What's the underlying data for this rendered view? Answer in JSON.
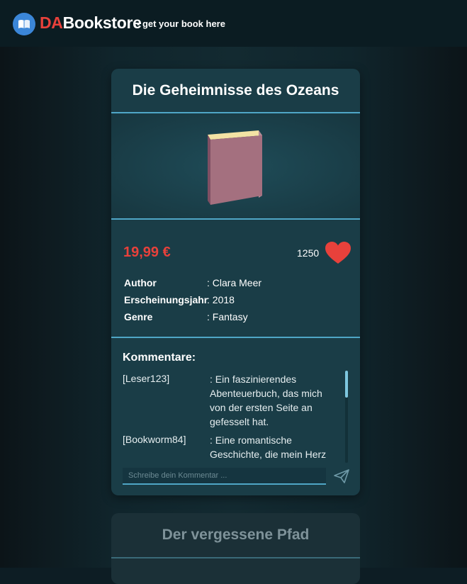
{
  "header": {
    "brand_prefix": "DA",
    "brand_rest": "Bookstore",
    "tagline": "- get your book here",
    "logo_icon": "book-icon"
  },
  "book": {
    "title": "Die Geheimnisse des Ozeans",
    "price": "19,99 €",
    "likes": "1250",
    "details": [
      {
        "label": "Author",
        "value": ": Clara Meer"
      },
      {
        "label": "Erscheinungsjahr",
        "value": ": 2018"
      },
      {
        "label": "Genre",
        "value": ": Fantasy"
      }
    ],
    "comments_title": "Kommentare:",
    "comments": [
      {
        "user": "[Leser123]",
        "text": ": Ein faszinierendes Abenteuerbuch, das mich von der ersten Seite an gefesselt hat."
      },
      {
        "user": "[Bookworm84]",
        "text": ": Eine romantische Geschichte, die mein Herz"
      }
    ],
    "comment_placeholder": "Schreibe dein Kommentar ..."
  },
  "next_book": {
    "title": "Der vergessene Pfad"
  },
  "colors": {
    "accent": "#e8413b",
    "card": "#1a3d47",
    "separator": "#4fa6c6"
  }
}
